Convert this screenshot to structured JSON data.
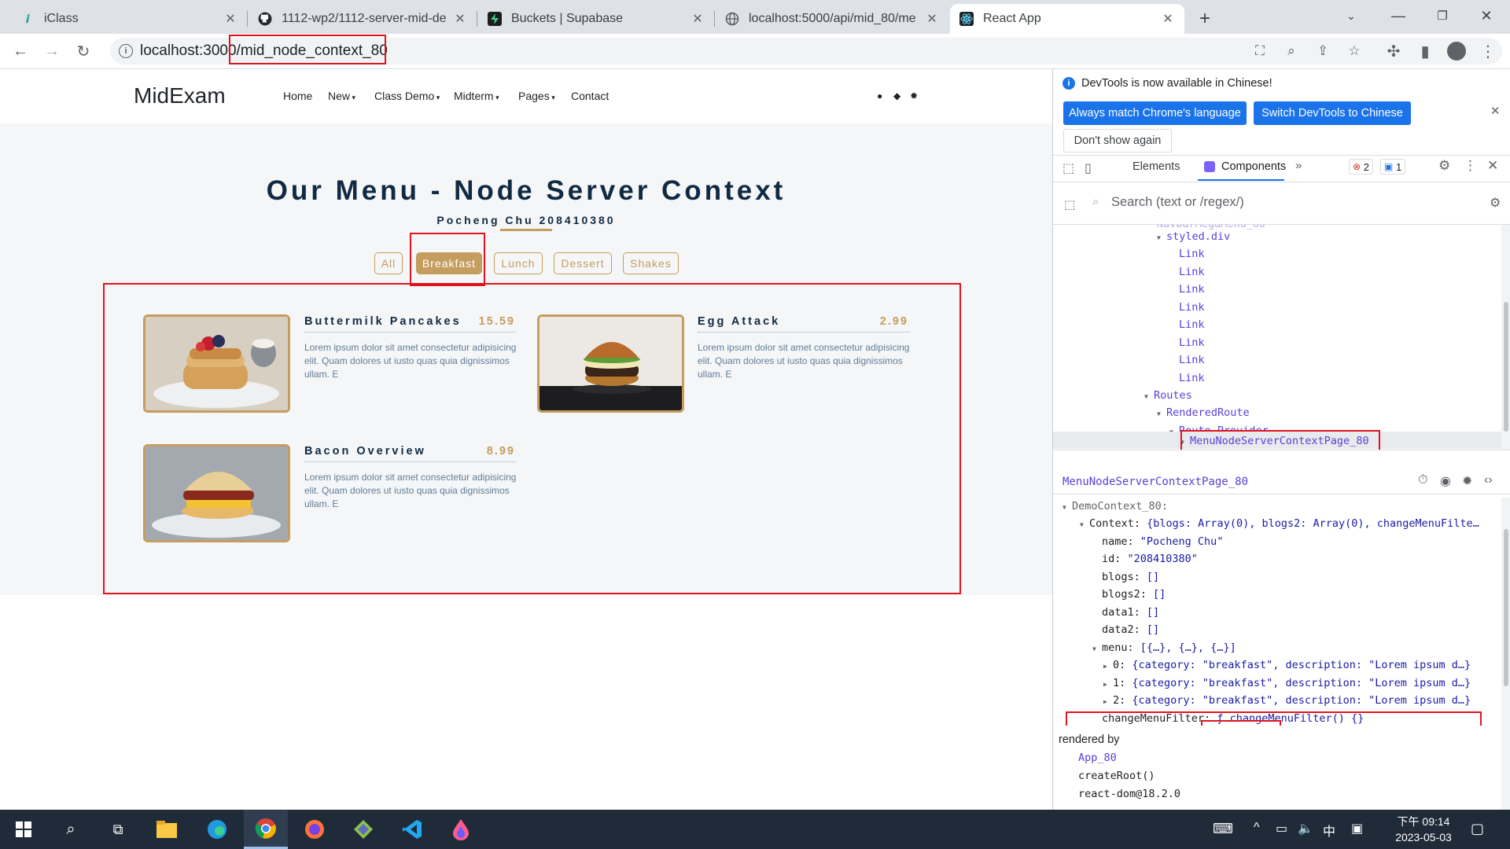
{
  "browser": {
    "tabs": [
      {
        "title": "iClass",
        "icon": "iclass-icon"
      },
      {
        "title": "1112-wp2/1112-server-mid-de",
        "icon": "github-icon"
      },
      {
        "title": "Buckets | Supabase",
        "icon": "supabase-icon"
      },
      {
        "title": "localhost:5000/api/mid_80/me",
        "icon": "globe-icon"
      },
      {
        "title": "React App",
        "icon": "react-icon"
      }
    ],
    "url_host": "localhost:3000",
    "url_path": "/mid_node_context_80"
  },
  "site": {
    "brand": "MidExam",
    "nav": [
      "Home",
      "New",
      "Class Demo",
      "Midterm",
      "Pages",
      "Contact"
    ],
    "menu_title": "Our Menu - Node Server Context",
    "menu_subtitle": "Pocheng Chu 208410380",
    "filters": [
      "All",
      "Breakfast",
      "Lunch",
      "Dessert",
      "Shakes"
    ],
    "active_filter": "Breakfast",
    "items": [
      {
        "title": "Buttermilk Pancakes",
        "price": "15.59",
        "desc": "Lorem ipsum dolor sit amet consectetur adipisicing elit. Quam dolores ut iusto quas quia dignissimos ullam. E"
      },
      {
        "title": "Egg Attack",
        "price": "2.99",
        "desc": "Lorem ipsum dolor sit amet consectetur adipisicing elit. Quam dolores ut iusto quas quia dignissimos ullam. E"
      },
      {
        "title": "Bacon Overview",
        "price": "8.99",
        "desc": "Lorem ipsum dolor sit amet consectetur adipisicing elit. Quam dolores ut iusto quas quia dignissimos ullam. E"
      }
    ]
  },
  "devtools": {
    "banner": "DevTools is now available in Chinese!",
    "btn_match": "Always match Chrome's language",
    "btn_switch": "Switch DevTools to Chinese",
    "btn_dont": "Don't show again",
    "tab_elements": "Elements",
    "tab_components": "Components",
    "errors": "2",
    "messages": "1",
    "search_placeholder": "Search (text or /regex/)",
    "tree": {
      "styled_div": "styled.div",
      "link": "Link",
      "routes": "Routes",
      "rendered_route": "RenderedRoute",
      "route_provider": "Route.Provider",
      "selected": "MenuNodeServerContextPage_80"
    },
    "selected_component": "MenuNodeServerContextPage_80",
    "props": {
      "context_name": "DemoContext_80:",
      "context_summary": "{blogs: Array(0), blogs2: Array(0), changeMenuFilte…",
      "name_val": "\"Pocheng Chu\"",
      "id_val": "\"208410380\"",
      "menu_summary": "[{…}, {…}, {…}]",
      "menu_row_prefix": "{category: ",
      "menu_category": "\"breakfast\"",
      "menu_row_suffix": ", description: \"Lorem ipsum d…}",
      "change_fn": "ƒ changeMenuFilter() {}"
    },
    "rendered_by": "rendered by",
    "rendered_by_list": [
      "App_80",
      "createRoot()",
      "react-dom@18.2.0"
    ]
  },
  "taskbar": {
    "time": "下午 09:14",
    "date": "2023-05-03",
    "ime": "中"
  }
}
